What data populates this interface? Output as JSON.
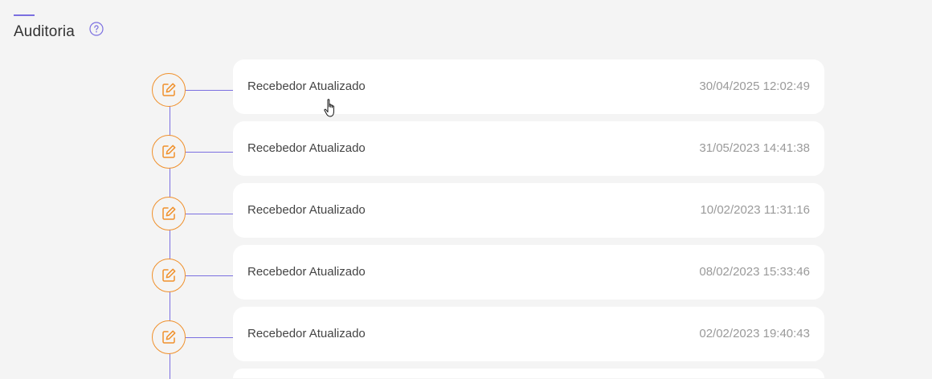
{
  "header": {
    "title": "Auditoria",
    "help_icon": "question-circle-icon",
    "accent_color": "#7b6fe0"
  },
  "timeline": {
    "line_color": "#7b6fe0",
    "icon_color": "#f0902b",
    "icon": "edit-pencil-icon",
    "entries": [
      {
        "label": "Recebedor Atualizado",
        "datetime": "30/04/2025 12:02:49"
      },
      {
        "label": "Recebedor Atualizado",
        "datetime": "31/05/2023 14:41:38"
      },
      {
        "label": "Recebedor Atualizado",
        "datetime": "10/02/2023 11:31:16"
      },
      {
        "label": "Recebedor Atualizado",
        "datetime": "08/02/2023 15:33:46"
      },
      {
        "label": "Recebedor Atualizado",
        "datetime": "02/02/2023 19:40:43"
      }
    ]
  }
}
